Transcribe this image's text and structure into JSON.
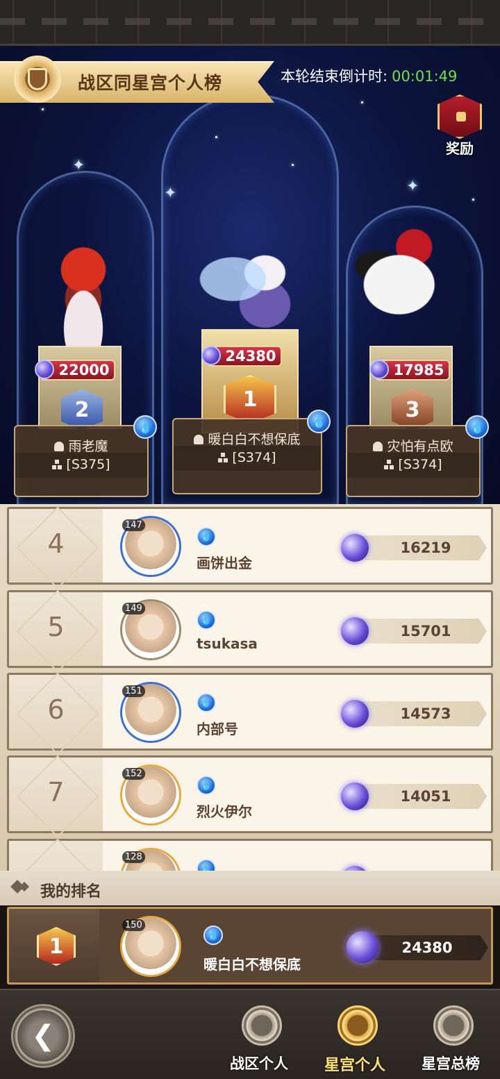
{
  "header": {
    "title": "战区同星宫个人榜",
    "countdown_label": "本轮结束倒计时:",
    "countdown_value": "00:01:49",
    "reward_label": "奖励"
  },
  "podium": [
    {
      "rank": "2",
      "score": "22000",
      "name": "雨老魔",
      "server": "[S375]"
    },
    {
      "rank": "1",
      "score": "24380",
      "name": "暖白白不想保底",
      "server": "[S374]"
    },
    {
      "rank": "3",
      "score": "17985",
      "name": "灾怕有点欧",
      "server": "[S374]"
    }
  ],
  "list": [
    {
      "rank": "4",
      "level": "147",
      "name": "画饼出金",
      "score": "16219"
    },
    {
      "rank": "5",
      "level": "149",
      "name": "tsukasa",
      "score": "15701"
    },
    {
      "rank": "6",
      "level": "151",
      "name": "内部号",
      "score": "14573"
    },
    {
      "rank": "7",
      "level": "152",
      "name": "烈火伊尔",
      "score": "14051"
    },
    {
      "rank": "",
      "level": "128",
      "name": "",
      "score": ""
    }
  ],
  "my_rank": {
    "header": "我的排名",
    "rank": "1",
    "level": "150",
    "name": "暖白白不想保底",
    "score": "24380"
  },
  "nav": {
    "tab1": "战区个人",
    "tab2": "星宫个人",
    "tab3": "星宫总榜",
    "active": "星宫个人"
  },
  "colors": {
    "countdown_green": "#6ee24a",
    "active_tab": "#ffe27a",
    "score_tag_red": "#d2354b"
  },
  "icons": [
    "shield-icon",
    "chest-icon",
    "water-element-icon",
    "person-icon",
    "server-icon",
    "star-orb-icon",
    "back-arrow-icon",
    "rank-medal-icon"
  ]
}
